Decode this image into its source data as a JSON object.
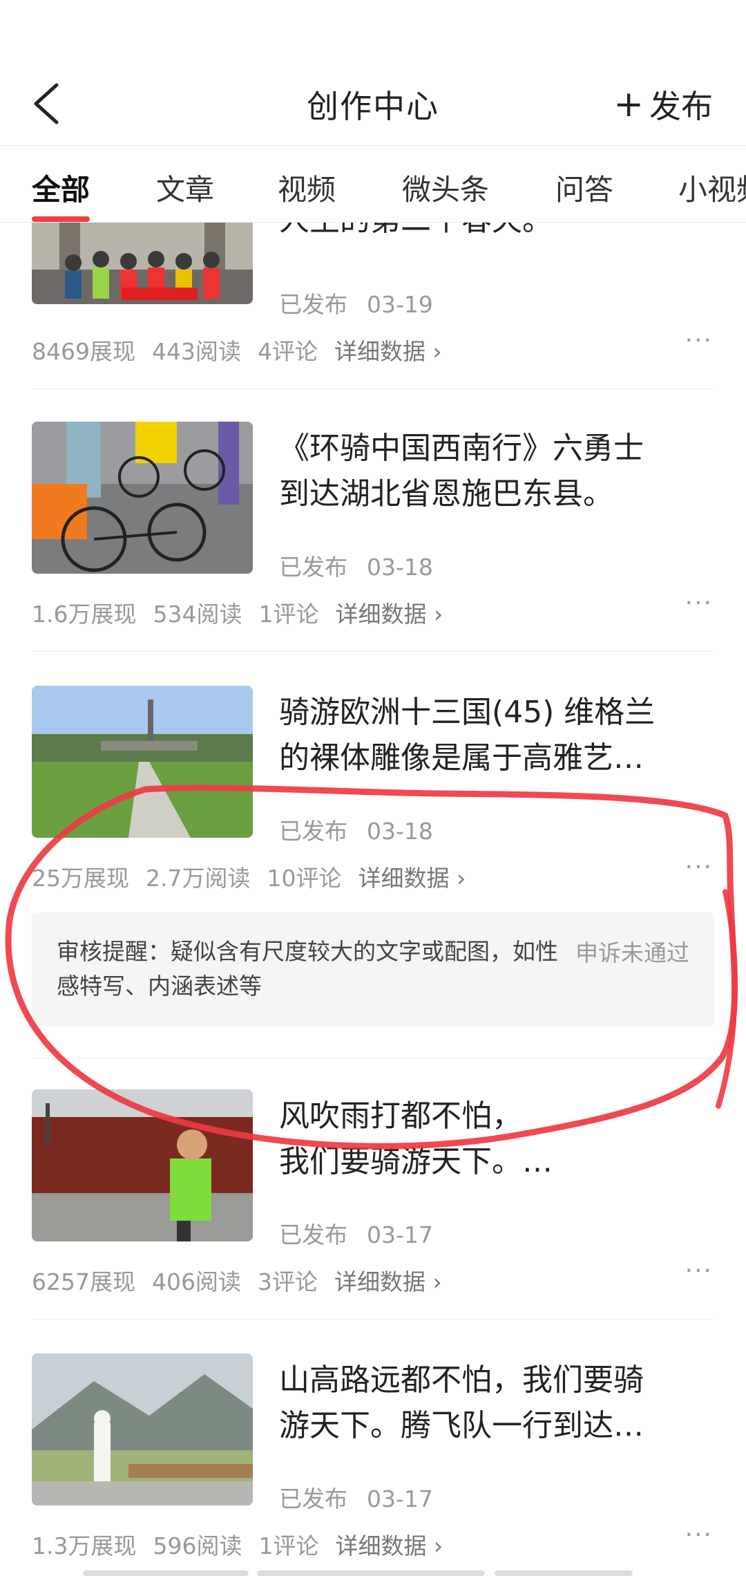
{
  "header": {
    "title": "创作中心",
    "publish_label": "发布"
  },
  "tabs": [
    "全部",
    "文章",
    "视频",
    "微头条",
    "问答",
    "小视频"
  ],
  "articles": [
    {
      "title": "人生的第二个春天。",
      "status": "已发布",
      "date": "03-19",
      "impressions": "8469展现",
      "reads": "443阅读",
      "comments": "4评论",
      "detail": "详细数据 ›"
    },
    {
      "title": "《环骑中国西南行》六勇士\n到达湖北省恩施巴东县。",
      "status": "已发布",
      "date": "03-18",
      "impressions": "1.6万展现",
      "reads": "534阅读",
      "comments": "1评论",
      "detail": "详细数据 ›"
    },
    {
      "title": "骑游欧洲十三国(45) 维格兰\n的裸体雕像是属于高雅艺…",
      "status": "已发布",
      "date": "03-18",
      "impressions": "25万展现",
      "reads": "2.7万阅读",
      "comments": "10评论",
      "detail": "详细数据 ›",
      "review_notice": "审核提醒：疑似含有尺度较大的文字或配图，如性感特写、内涵表述等",
      "appeal_status": "申诉未通过"
    },
    {
      "title": "风吹雨打都不怕，\n我们要骑游天下。…",
      "status": "已发布",
      "date": "03-17",
      "impressions": "6257展现",
      "reads": "406阅读",
      "comments": "3评论",
      "detail": "详细数据 ›"
    },
    {
      "title": "山高路远都不怕，我们要骑\n游天下。腾飞队一行到达…",
      "status": "已发布",
      "date": "03-17",
      "impressions": "1.3万展现",
      "reads": "596阅读",
      "comments": "1评论",
      "detail": "详细数据 ›"
    }
  ],
  "more_icon": "···",
  "colors": {
    "accent": "#f04142",
    "annotation": "#ee3a42"
  }
}
